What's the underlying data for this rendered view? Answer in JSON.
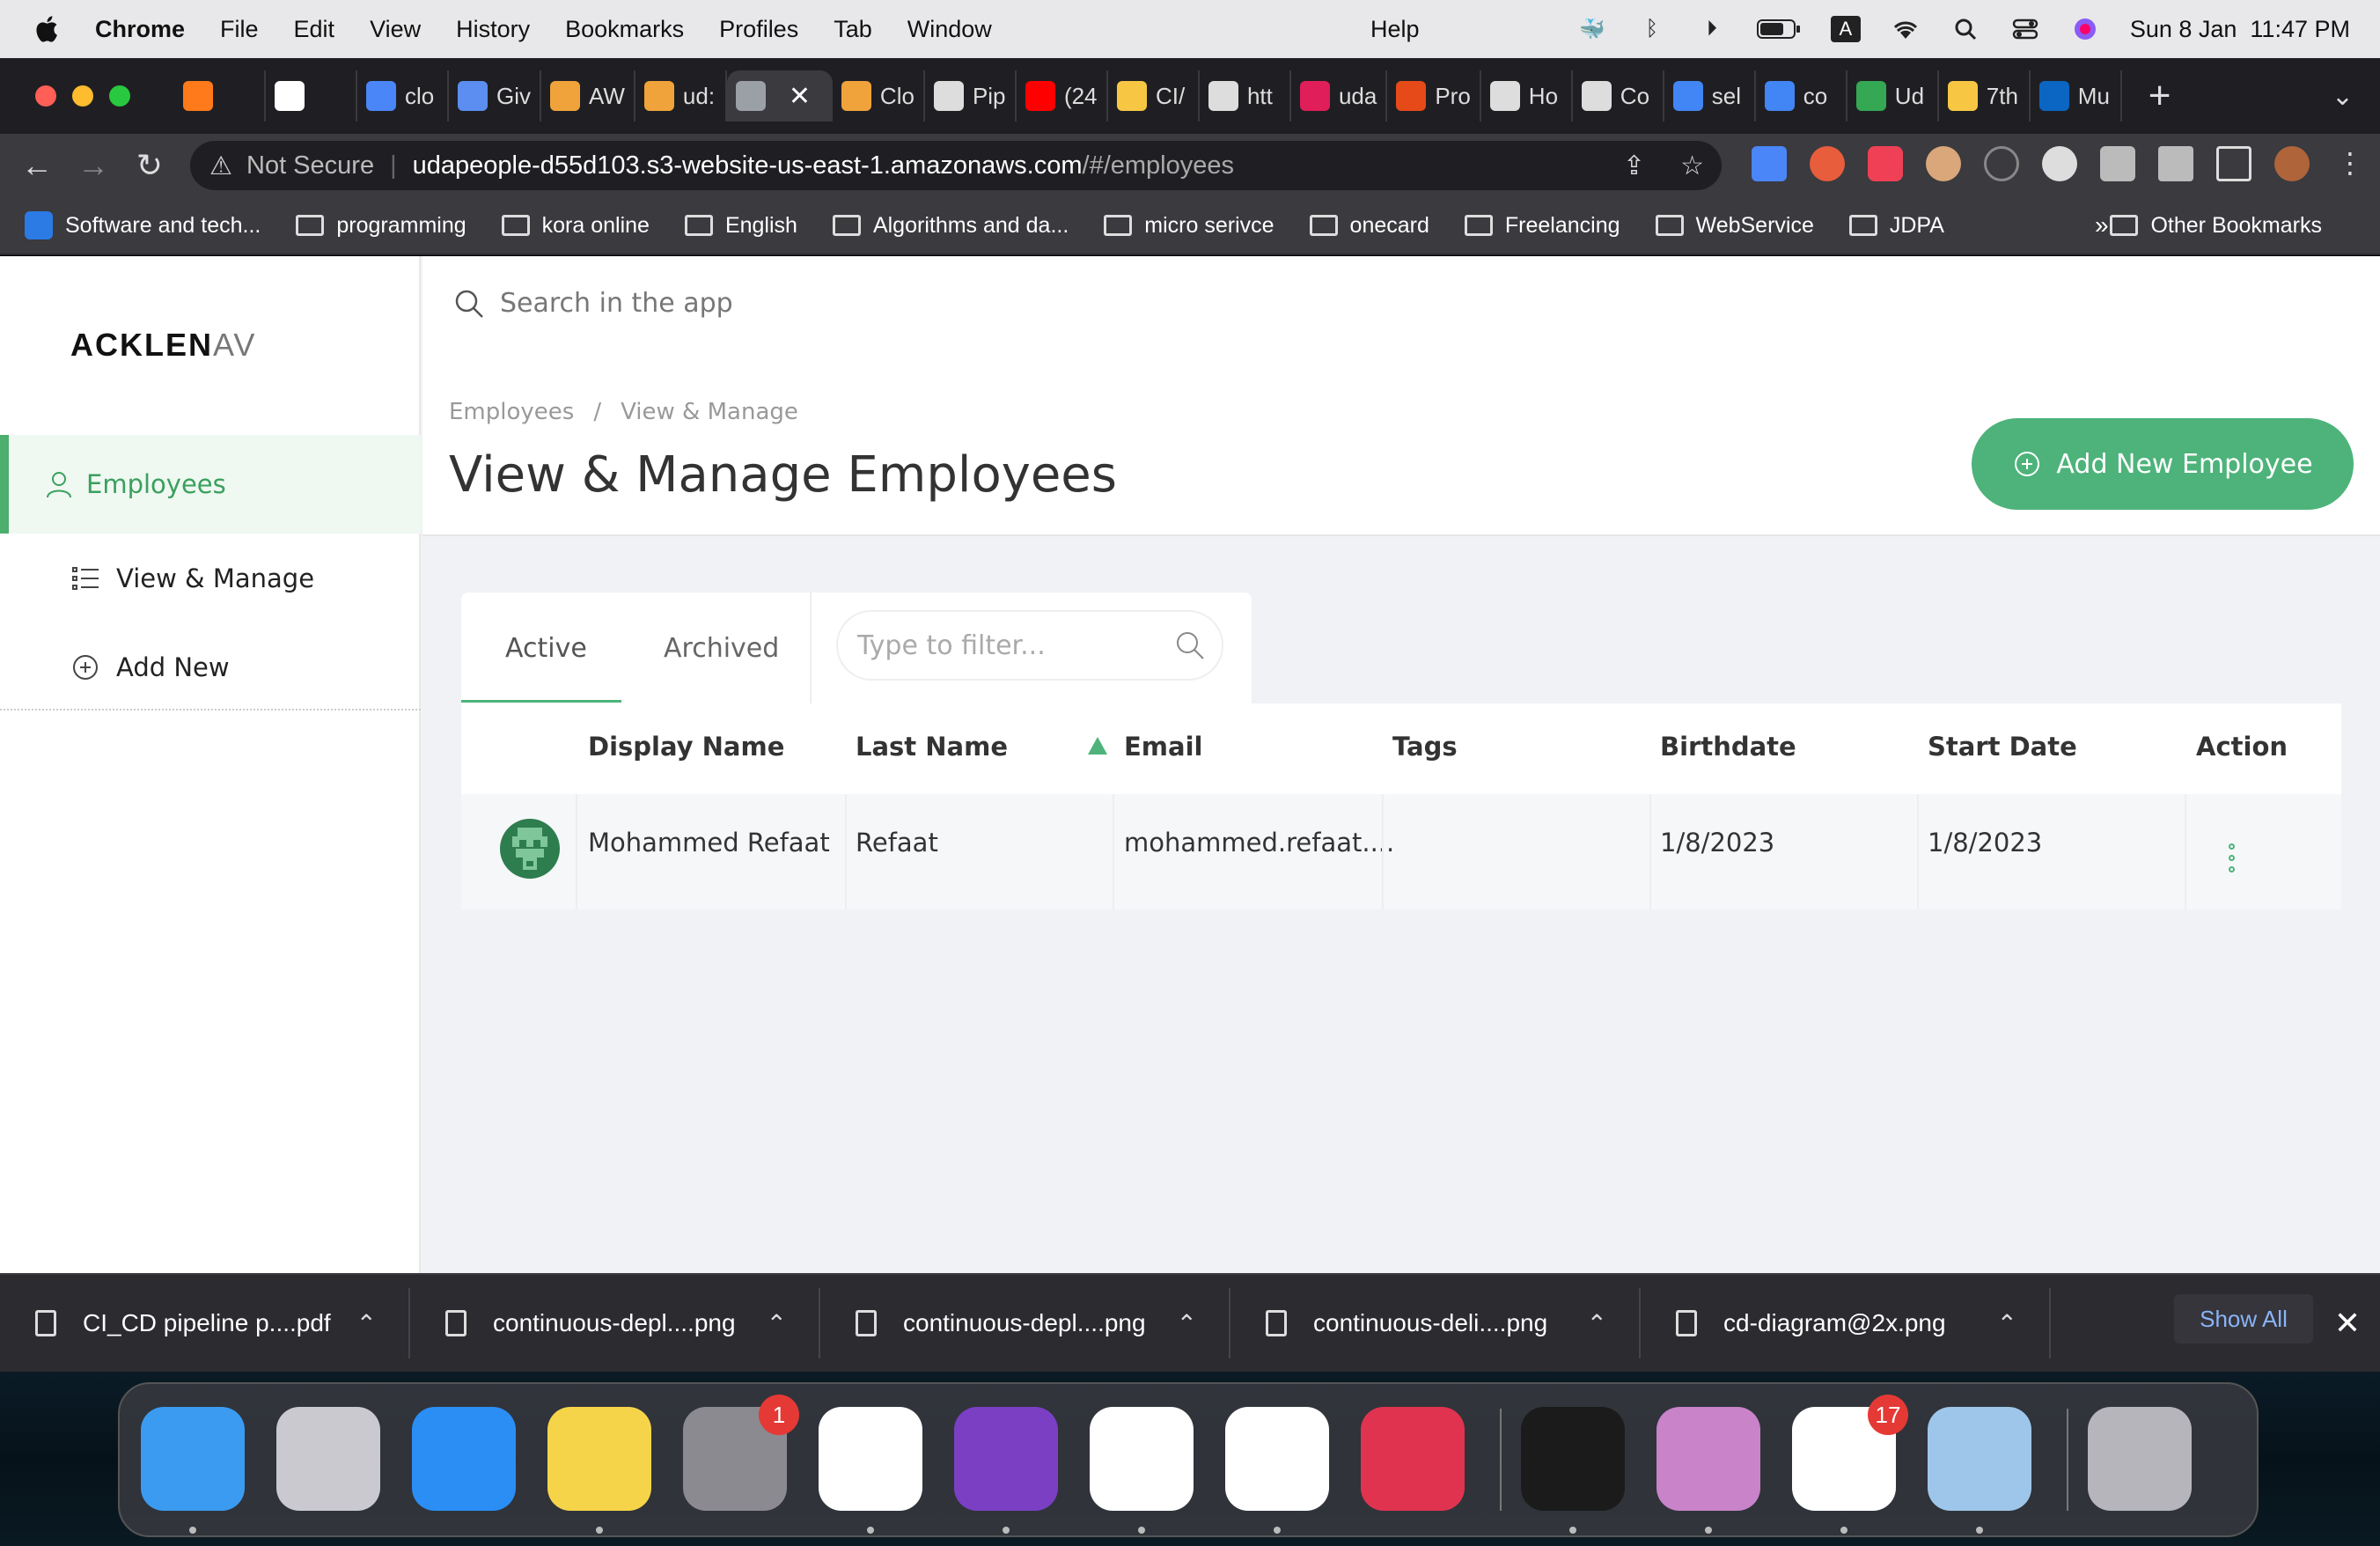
{
  "menubar": {
    "app": "Chrome",
    "items": [
      "File",
      "Edit",
      "View",
      "History",
      "Bookmarks",
      "Profiles",
      "Tab",
      "Window"
    ],
    "help": "Help",
    "datetime": "Sun 8 Jan  11:47 PM",
    "input_source": "A"
  },
  "tabs": [
    {
      "label": "",
      "color": "#ff7a1a"
    },
    {
      "label": "",
      "color": "#ffffff"
    },
    {
      "label": "clo",
      "color": "#4a86f7"
    },
    {
      "label": "Giv",
      "color": "#5b8ef0"
    },
    {
      "label": "AW",
      "color": "#f0a33a"
    },
    {
      "label": "ud:",
      "color": "#f0a33a"
    },
    {
      "label": "",
      "color": "#9aa0a6",
      "active": true
    },
    {
      "label": "Clo",
      "color": "#f0a33a"
    },
    {
      "label": "Pip",
      "color": "#dddddd"
    },
    {
      "label": "(24",
      "color": "#ff0000"
    },
    {
      "label": "CI/",
      "color": "#f7c744"
    },
    {
      "label": "htt",
      "color": "#dddddd"
    },
    {
      "label": "uda",
      "color": "#e01e5a"
    },
    {
      "label": "Pro",
      "color": "#e64a19"
    },
    {
      "label": "Ho",
      "color": "#dddddd"
    },
    {
      "label": "Co",
      "color": "#dddddd"
    },
    {
      "label": "sel",
      "color": "#4285f4"
    },
    {
      "label": "co",
      "color": "#4285f4"
    },
    {
      "label": "Ud",
      "color": "#34a853"
    },
    {
      "label": "7th",
      "color": "#f7c744"
    },
    {
      "label": "Mu",
      "color": "#0a66c2"
    }
  ],
  "address": {
    "security": "Not Secure",
    "url_host": "udapeople-d55d103.s3-website-us-east-1.amazonaws.com",
    "url_path": "/#/employees"
  },
  "bookmarks": [
    "Software and tech...",
    "programming",
    "kora online",
    "English",
    "Algorithms and da...",
    "micro serivce",
    "onecard",
    "Freelancing",
    "WebService",
    "JDPA"
  ],
  "bookmarks_more": "»",
  "other_bookmarks": "Other Bookmarks",
  "app": {
    "logo_main": "ACKLEN",
    "logo_fade": "AV",
    "sidebar": {
      "section": "Employees",
      "items": [
        "View & Manage",
        "Add New"
      ]
    },
    "search_placeholder": "Search in the app",
    "breadcrumb": [
      "Employees",
      "View & Manage"
    ],
    "breadcrumb_sep": "/",
    "title": "View & Manage Employees",
    "add_button": "Add New Employee",
    "tabs": [
      "Active",
      "Archived"
    ],
    "filter_placeholder": "Type to filter...",
    "columns": [
      "Display Name",
      "Last Name",
      "Email",
      "Tags",
      "Birthdate",
      "Start Date",
      "Action"
    ],
    "rows": [
      {
        "display_name": "Mohammed Refaat",
        "last_name": "Refaat",
        "email": "mohammed.refaat....",
        "tags": "",
        "birthdate": "1/8/2023",
        "start_date": "1/8/2023"
      }
    ]
  },
  "downloads": {
    "files": [
      "CI_CD pipeline p....pdf",
      "continuous-depl....png",
      "continuous-depl....png",
      "continuous-deli....png",
      "cd-diagram@2x.png"
    ],
    "show_all": "Show All"
  },
  "dock": {
    "apps": [
      {
        "name": "finder-icon",
        "color": "#3b9bf0"
      },
      {
        "name": "launchpad-icon",
        "color": "#c9c9cf"
      },
      {
        "name": "safari-icon",
        "color": "#2a8ef5"
      },
      {
        "name": "notes-icon",
        "color": "#f6d44a"
      },
      {
        "name": "system-settings-icon",
        "color": "#8a8a90",
        "badge": "1"
      },
      {
        "name": "vscode-icon",
        "color": "#ffffff"
      },
      {
        "name": "github-desktop-icon",
        "color": "#7b3fc4"
      },
      {
        "name": "chrome-icon",
        "color": "#ffffff"
      },
      {
        "name": "teams-icon",
        "color": "#ffffff"
      },
      {
        "name": "intellij-icon",
        "color": "#e0334f"
      },
      {
        "name": "terminal-icon",
        "color": "#1b1b1b"
      },
      {
        "name": "octopus-icon",
        "color": "#c883c9"
      },
      {
        "name": "slack-icon",
        "color": "#ffffff",
        "badge": "17"
      },
      {
        "name": "preview-icon",
        "color": "#9ec6ea"
      },
      {
        "name": "trash-icon",
        "color": "#b5b5bb"
      }
    ]
  }
}
